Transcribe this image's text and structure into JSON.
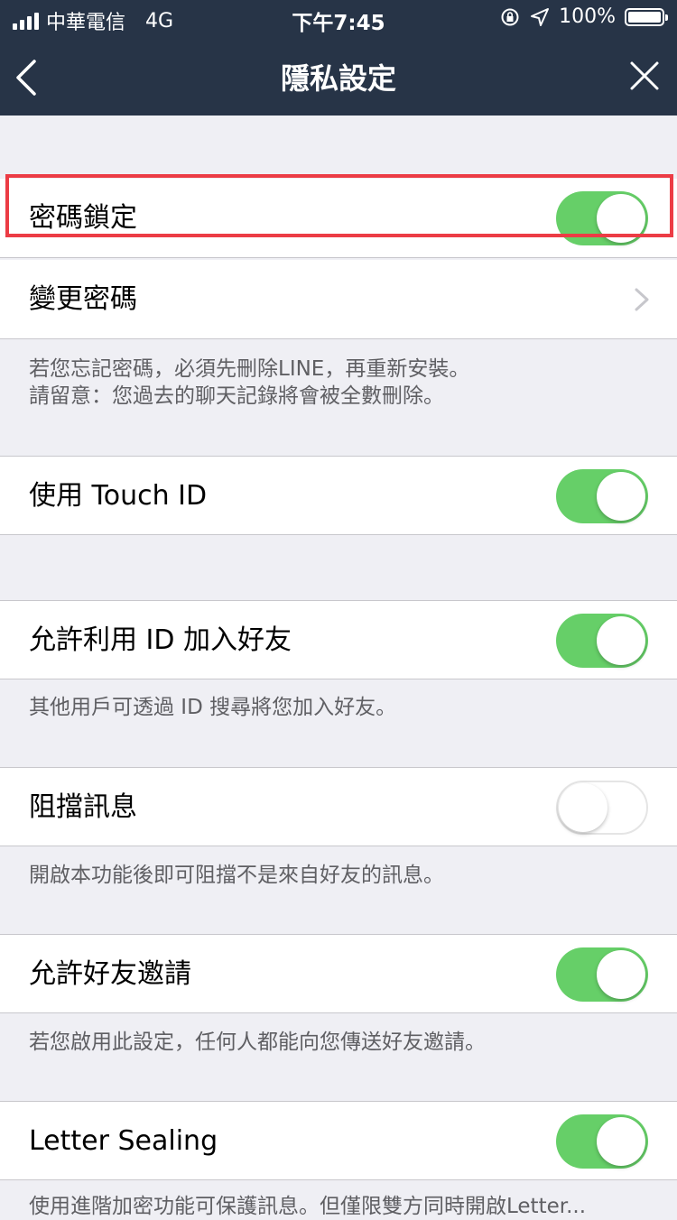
{
  "status": {
    "carrier": "中華電信",
    "network": "4G",
    "time": "下午7:45",
    "battery": "100%"
  },
  "nav": {
    "title": "隱私設定"
  },
  "settings": {
    "passcode_lock": {
      "label": "密碼鎖定",
      "enabled": true
    },
    "change_passcode": {
      "label": "變更密碼"
    },
    "passcode_note_1": "若您忘記密碼，必須先刪除LINE，再重新安裝。",
    "passcode_note_2": "請留意：您過去的聊天記錄將會被全數刪除。",
    "touch_id": {
      "label": "使用 Touch ID",
      "enabled": true
    },
    "allow_id_add": {
      "label": "允許利用 ID 加入好友",
      "enabled": true
    },
    "allow_id_note": "其他用戶可透過 ID 搜尋將您加入好友。",
    "block_messages": {
      "label": "阻擋訊息",
      "enabled": false
    },
    "block_note": "開啟本功能後即可阻擋不是來自好友的訊息。",
    "allow_invites": {
      "label": "允許好友邀請",
      "enabled": true
    },
    "invites_note": "若您啟用此設定，任何人都能向您傳送好友邀請。",
    "letter_sealing": {
      "label": "Letter Sealing",
      "enabled": true
    },
    "letter_note": "使用進階加密功能可保護訊息。但僅限雙方同時開啟Letter..."
  },
  "colors": {
    "nav_bg": "#273447",
    "toggle_on": "#66cf68",
    "highlight": "#ec3c45",
    "page_bg": "#efeff4"
  }
}
